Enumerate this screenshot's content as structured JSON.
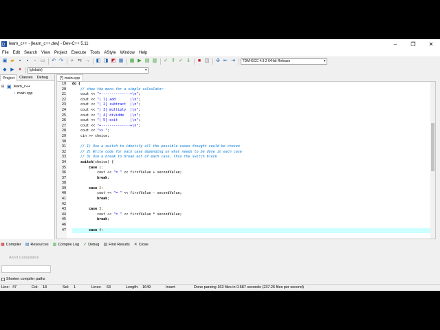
{
  "window": {
    "title": "learn_c++ - [learn_c++.dev] - Dev-C++ 5.11"
  },
  "menu": [
    "File",
    "Edit",
    "Search",
    "View",
    "Project",
    "Execute",
    "Tools",
    "AStyle",
    "Window",
    "Help"
  ],
  "toolbar": {
    "compiler_select": "TDM-GCC 4.9.2 64-bit Release",
    "globals_select": "(globals)"
  },
  "left_panel": {
    "tabs": [
      "Project",
      "Classes",
      "Debug"
    ],
    "active_tab": "Project",
    "project_name": "learn_c++",
    "file_name": "main.cpp"
  },
  "editor": {
    "tab_label": "[*] main.cpp",
    "line_numbers": [
      "19",
      "20",
      "21",
      "22",
      "23",
      "24",
      "25",
      "26",
      "27",
      "28",
      "29",
      "30",
      "31",
      "32",
      "33",
      "34",
      "35",
      "36",
      "37",
      "38",
      "39",
      "40",
      "41",
      "42",
      "43",
      "44",
      "45",
      "46",
      "47"
    ],
    "lines": [
      {
        "indent": "",
        "parts": [
          {
            "t": "do {",
            "c": "kw"
          }
        ]
      },
      {
        "indent": "    ",
        "parts": [
          {
            "t": "// show the menu for a simple calculator",
            "c": "comment"
          }
        ]
      },
      {
        "indent": "    ",
        "parts": [
          {
            "t": "cout << ",
            "c": ""
          },
          {
            "t": "\"+--------------+\\n\"",
            "c": "str"
          },
          {
            "t": ";",
            "c": ""
          }
        ]
      },
      {
        "indent": "    ",
        "parts": [
          {
            "t": "cout << ",
            "c": ""
          },
          {
            "t": "\"| 1] add       |\\n\"",
            "c": "str"
          },
          {
            "t": ";",
            "c": ""
          }
        ]
      },
      {
        "indent": "    ",
        "parts": [
          {
            "t": "cout << ",
            "c": ""
          },
          {
            "t": "\"| 2] subtract  |\\n\"",
            "c": "str"
          },
          {
            "t": ";",
            "c": ""
          }
        ]
      },
      {
        "indent": "    ",
        "parts": [
          {
            "t": "cout << ",
            "c": ""
          },
          {
            "t": "\"| 3] multiply  |\\n\"",
            "c": "str"
          },
          {
            "t": ";",
            "c": ""
          }
        ]
      },
      {
        "indent": "    ",
        "parts": [
          {
            "t": "cout << ",
            "c": ""
          },
          {
            "t": "\"| 4] dividde   |\\n\"",
            "c": "str"
          },
          {
            "t": ";",
            "c": ""
          }
        ]
      },
      {
        "indent": "    ",
        "parts": [
          {
            "t": "cout << ",
            "c": ""
          },
          {
            "t": "\"| 5] exit      |\\n\"",
            "c": "str"
          },
          {
            "t": ";",
            "c": ""
          }
        ]
      },
      {
        "indent": "    ",
        "parts": [
          {
            "t": "cout << ",
            "c": ""
          },
          {
            "t": "\"+--------------+\\n\"",
            "c": "str"
          },
          {
            "t": ";",
            "c": ""
          }
        ]
      },
      {
        "indent": "    ",
        "parts": [
          {
            "t": "cout << ",
            "c": ""
          },
          {
            "t": "\">> \"",
            "c": "str"
          },
          {
            "t": ";",
            "c": ""
          }
        ]
      },
      {
        "indent": "    ",
        "parts": [
          {
            "t": "cin >> choice;",
            "c": ""
          }
        ]
      },
      {
        "indent": "",
        "parts": []
      },
      {
        "indent": "    ",
        "parts": [
          {
            "t": "// 1) Use a switch to identify all the possible cases thought could be chosen",
            "c": "comment"
          }
        ]
      },
      {
        "indent": "    ",
        "parts": [
          {
            "t": "// 2) Write code for each case depending on what needs to be done in each case",
            "c": "comment"
          }
        ]
      },
      {
        "indent": "    ",
        "parts": [
          {
            "t": "// 3) Use a break to break out of each case, thus the switch block",
            "c": "comment"
          }
        ]
      },
      {
        "indent": "    ",
        "parts": [
          {
            "t": "switch",
            "c": "kw"
          },
          {
            "t": "(choice) {",
            "c": ""
          }
        ]
      },
      {
        "indent": "        ",
        "parts": [
          {
            "t": "case ",
            "c": "kw"
          },
          {
            "t": "1",
            "c": "num"
          },
          {
            "t": ":",
            "c": ""
          }
        ]
      },
      {
        "indent": "            ",
        "parts": [
          {
            "t": "cout << ",
            "c": ""
          },
          {
            "t": "\"= \"",
            "c": "str"
          },
          {
            "t": " << firstValue + secondValue;",
            "c": ""
          }
        ]
      },
      {
        "indent": "            ",
        "parts": [
          {
            "t": "break",
            "c": "kw"
          },
          {
            "t": ";",
            "c": ""
          }
        ]
      },
      {
        "indent": "",
        "parts": []
      },
      {
        "indent": "        ",
        "parts": [
          {
            "t": "case ",
            "c": "kw"
          },
          {
            "t": "2",
            "c": "num"
          },
          {
            "t": ":",
            "c": ""
          }
        ]
      },
      {
        "indent": "            ",
        "parts": [
          {
            "t": "cout << ",
            "c": ""
          },
          {
            "t": "\"= \"",
            "c": "str"
          },
          {
            "t": " << firstValue - secondValue;",
            "c": ""
          }
        ]
      },
      {
        "indent": "            ",
        "parts": [
          {
            "t": "break",
            "c": "kw"
          },
          {
            "t": ";",
            "c": ""
          }
        ]
      },
      {
        "indent": "",
        "parts": []
      },
      {
        "indent": "        ",
        "parts": [
          {
            "t": "case ",
            "c": "kw"
          },
          {
            "t": "3",
            "c": "num"
          },
          {
            "t": ":",
            "c": ""
          }
        ]
      },
      {
        "indent": "            ",
        "parts": [
          {
            "t": "cout << ",
            "c": ""
          },
          {
            "t": "\"= \"",
            "c": "str"
          },
          {
            "t": " << firstValue * secondValue;",
            "c": ""
          }
        ]
      },
      {
        "indent": "            ",
        "parts": [
          {
            "t": "break",
            "c": "kw"
          },
          {
            "t": ";",
            "c": ""
          }
        ]
      },
      {
        "indent": "",
        "parts": []
      },
      {
        "indent": "        ",
        "parts": [
          {
            "t": "case ",
            "c": "kw"
          },
          {
            "t": "4",
            "c": "num"
          },
          {
            "t": ":",
            "c": ""
          }
        ],
        "current": true
      }
    ]
  },
  "bottom_tabs": [
    "Compiler",
    "Resources",
    "Compile Log",
    "Debug",
    "Find Results",
    "Close"
  ],
  "bottom_panel": {
    "abort_label": "Abort Compilation",
    "shorten_label": "Shorten compiler paths"
  },
  "status": {
    "line_label": "Line:",
    "line_value": "47",
    "col_label": "Col:",
    "col_value": "18",
    "sel_label": "Sel:",
    "sel_value": "1",
    "lines_label": "Lines:",
    "lines_value": "63",
    "length_label": "Length:",
    "length_value": "1649",
    "mode": "Insert",
    "message": "Done parsing 163 files in 0.687 seconds (237.26 files per second)"
  },
  "colors": {
    "comment": "#0078d7",
    "string": "#0000ff",
    "current_line": "#ccffff"
  }
}
